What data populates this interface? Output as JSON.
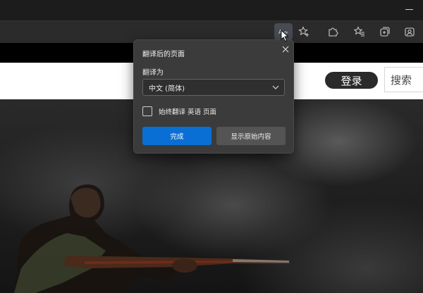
{
  "toolbar": {
    "icons": [
      "translate-icon",
      "favorite-add-icon",
      "extensions-icon",
      "favorites-icon",
      "collections-icon",
      "profile-icon"
    ]
  },
  "site": {
    "login_label": "登录",
    "search_placeholder": "搜索"
  },
  "translate_popup": {
    "title": "翻译后的页面",
    "translate_to_label": "翻译为",
    "selected_language": "中文 (简体)",
    "always_translate_label": "始终翻译 英语 页面",
    "always_translate_checked": false,
    "done_label": "完成",
    "show_original_label": "显示原始内容"
  },
  "colors": {
    "accent": "#0a6fd4",
    "popup_bg": "#3b3b3b",
    "toolbar_bg": "#2b2b2b"
  }
}
